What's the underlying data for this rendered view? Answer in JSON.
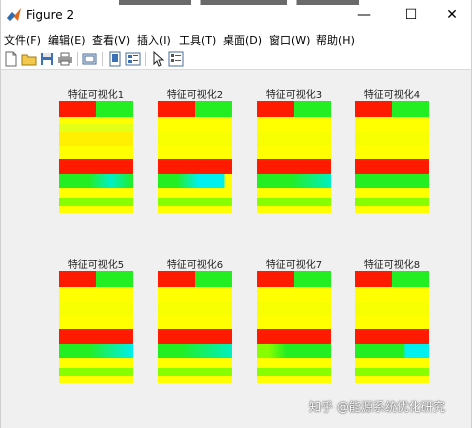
{
  "window": {
    "title": "Figure 2",
    "controls": {
      "minimize": "—",
      "maximize": "☐",
      "close": "✕"
    }
  },
  "menu": [
    "文件(F)",
    "编辑(E)",
    "查看(V)",
    "插入(I)",
    "工具(T)",
    "桌面(D)",
    "窗口(W)",
    "帮助(H)"
  ],
  "toolbar_icons": [
    "new-file-icon",
    "open-folder-icon",
    "save-icon",
    "print-icon",
    "link-figure-icon",
    "dock-icon",
    "property-editor-icon",
    "pointer-icon",
    "plot-browser-icon"
  ],
  "subplots": [
    {
      "title": "特征可视化1"
    },
    {
      "title": "特征可视化2"
    },
    {
      "title": "特征可视化3"
    },
    {
      "title": "特征可视化4"
    },
    {
      "title": "特征可视化5"
    },
    {
      "title": "特征可视化6"
    },
    {
      "title": "特征可视化7"
    },
    {
      "title": "特征可视化8"
    }
  ],
  "heatmap_colors": {
    "red": "#ff1a00",
    "green": "#22ee22",
    "yellow": "#ffff00",
    "yellow_light": "#f4ff10",
    "cyan": "#00f0f0",
    "lime": "#88ff00"
  },
  "watermark": "知乎 @能源系统优化研究"
}
